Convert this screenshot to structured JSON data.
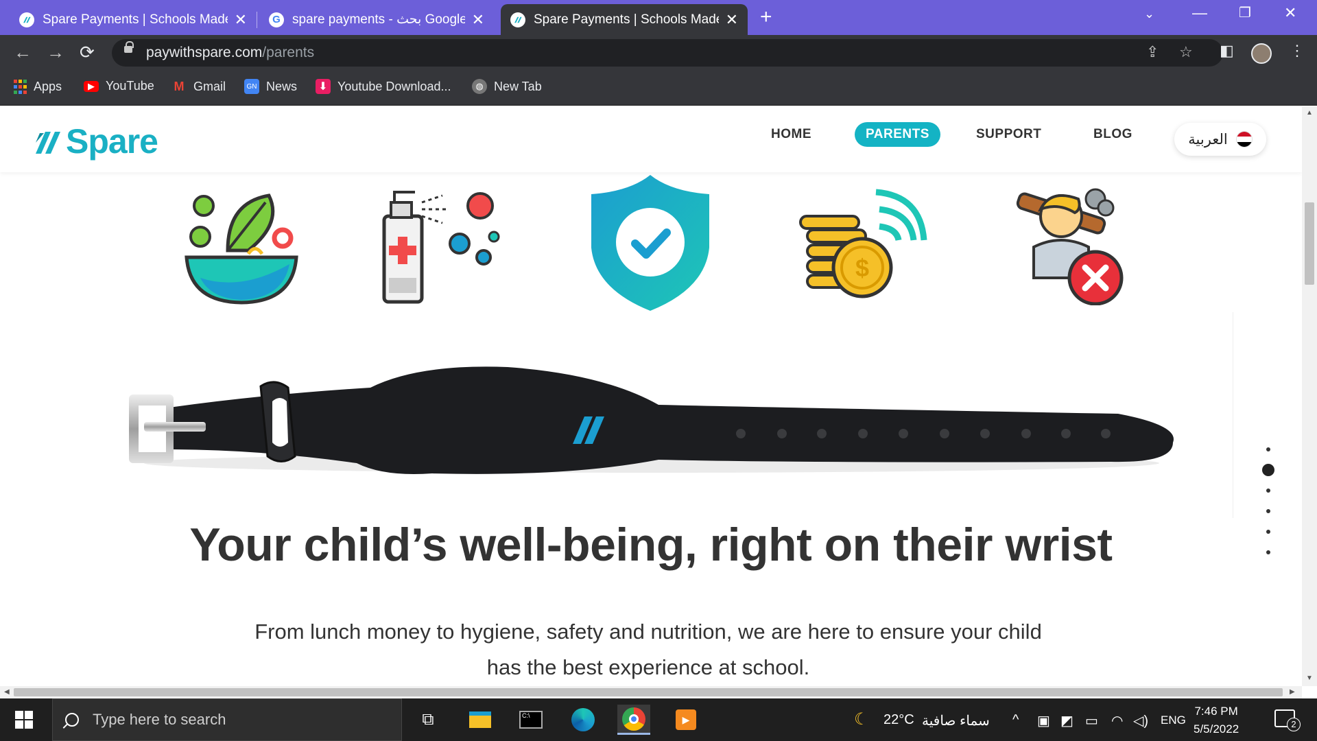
{
  "browser": {
    "tabs": [
      {
        "title": "Spare Payments | Schools Made S",
        "active": false,
        "favicon": "spare-logo"
      },
      {
        "title": "spare payments - بحث Google",
        "active": false,
        "favicon": "google-g"
      },
      {
        "title": "Spare Payments | Schools Made S",
        "active": true,
        "favicon": "spare-logo"
      }
    ],
    "url_domain": "paywithspare.com",
    "url_path": "/parents",
    "bookmarks": [
      {
        "label": "Apps",
        "icon": "apps-grid-icon"
      },
      {
        "label": "YouTube",
        "icon": "youtube-icon"
      },
      {
        "label": "Gmail",
        "icon": "gmail-icon"
      },
      {
        "label": "News",
        "icon": "news-icon"
      },
      {
        "label": "Youtube Download...",
        "icon": "download-icon"
      },
      {
        "label": "New Tab",
        "icon": "globe-icon"
      }
    ]
  },
  "site": {
    "logo_text": "Spare",
    "nav": {
      "home": "HOME",
      "parents": "PARENTS",
      "support": "SUPPORT",
      "blog": "BLOG"
    },
    "language": "العربية",
    "headline": "Your child’s well-being, right on their wrist",
    "subtext": "From lunch money to hygiene, safety and nutrition, we are here to ensure your child has the best experience at school.",
    "illustrations": [
      "salad-bowl-icon",
      "sanitizer-spray-icon",
      "shield-check-icon",
      "contactless-coins-icon",
      "bully-cross-icon"
    ],
    "side_nav_dots": 6,
    "side_nav_active": 2
  },
  "taskbar": {
    "search_placeholder": "Type here to search",
    "weather_temp": "22°C",
    "weather_text": "سماء صافية",
    "language": "ENG",
    "time": "7:46 PM",
    "date": "5/5/2022",
    "notification_count": "2"
  },
  "colors": {
    "tab_strip": "#6c5fd9",
    "brand_teal": "#14b3c4",
    "toolbar": "#35363a",
    "taskbar": "#1f1f1f"
  }
}
